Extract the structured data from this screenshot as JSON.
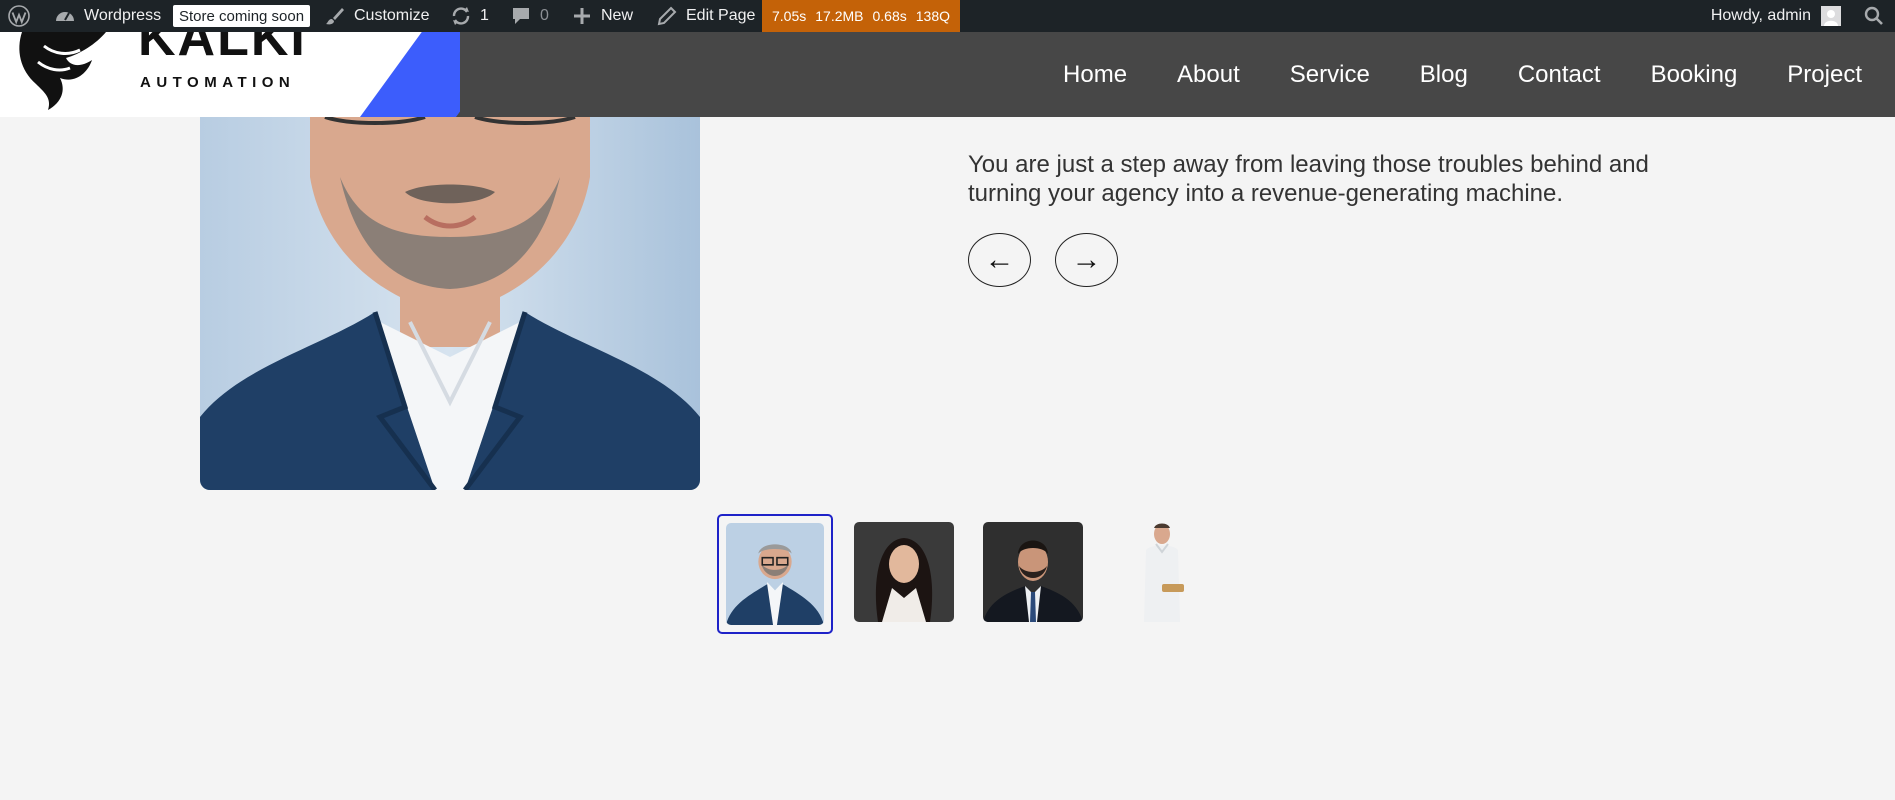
{
  "adminbar": {
    "site_name": "Wordpress",
    "store_badge": "Store coming soon",
    "customize": "Customize",
    "updates_count": "1",
    "comments_count": "0",
    "new_label": "New",
    "edit_page": "Edit Page",
    "qm": {
      "time": "7.05s",
      "memory": "17.2MB",
      "db_time": "0.68s",
      "queries": "138Q"
    },
    "howdy": "Howdy, admin"
  },
  "header": {
    "logo_word": "KALKI",
    "logo_sub": "AUTOMATION",
    "nav": [
      "Home",
      "About",
      "Service",
      "Blog",
      "Contact",
      "Booking",
      "Project"
    ]
  },
  "testimonial": {
    "quote": "You are just a step away from leaving those troubles behind and turning your agency into a revenue-generating machine.",
    "prev_label": "←",
    "next_label": "→"
  },
  "thumbnails": {
    "active_index": 0,
    "count": 4
  },
  "colors": {
    "adminbar_bg": "#1d2327",
    "qm_bg": "#c46208",
    "header_bg": "#474747",
    "accent_stripe": "#3c5dfc",
    "active_thumb_border": "#1e22c8",
    "page_bg": "#f4f4f4"
  },
  "icons": [
    "wordpress-icon",
    "dashboard-icon",
    "brush-icon",
    "refresh-icon",
    "comment-icon",
    "plus-icon",
    "pencil-icon",
    "avatar-icon",
    "search-icon",
    "logo-mark-icon"
  ]
}
